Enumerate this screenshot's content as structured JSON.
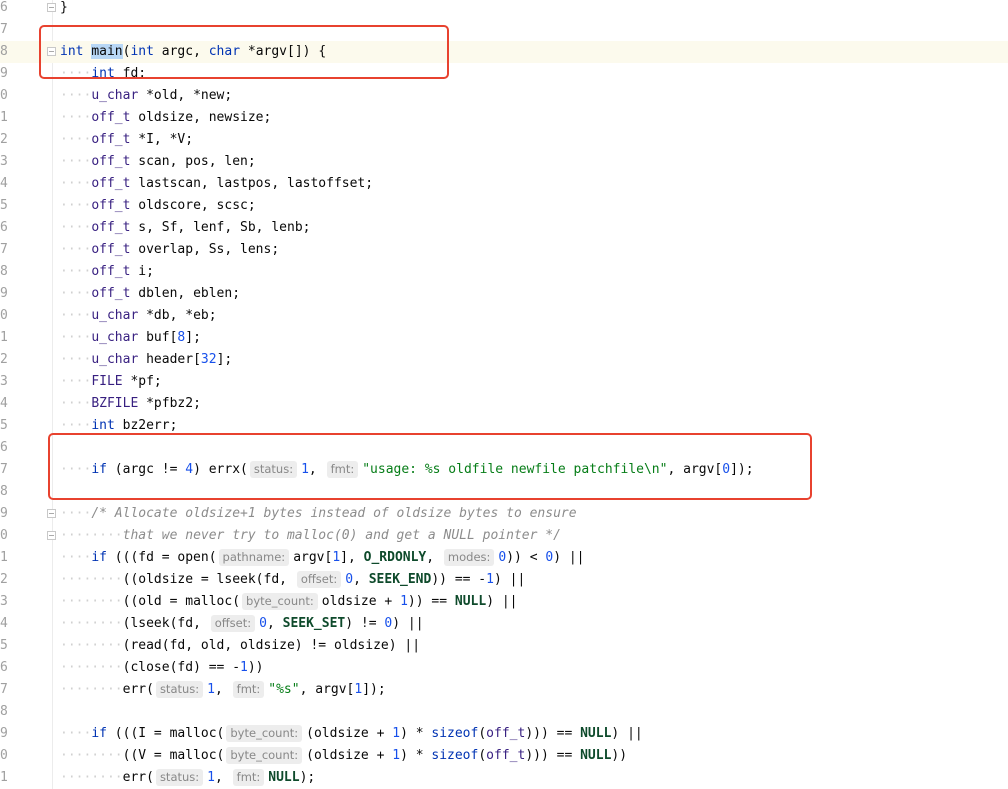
{
  "editor": {
    "current_line_index": 2,
    "accent_box_color": "#e8422f",
    "lines": [
      {
        "n": "6",
        "indent": 0,
        "fold": true,
        "tokens": [
          [
            "p",
            "}"
          ]
        ]
      },
      {
        "n": "7",
        "indent": 0,
        "tokens": []
      },
      {
        "n": "8",
        "indent": 0,
        "fold": true,
        "tokens": [
          [
            "kw",
            "int"
          ],
          [
            "p",
            " "
          ],
          [
            "sel",
            "main"
          ],
          [
            "p",
            "("
          ],
          [
            "kw",
            "int"
          ],
          [
            "p",
            " argc, "
          ],
          [
            "kw",
            "char"
          ],
          [
            "p",
            " *argv[]) {"
          ]
        ]
      },
      {
        "n": "9",
        "indent": 4,
        "tokens": [
          [
            "kw",
            "int"
          ],
          [
            "p",
            " fd;"
          ]
        ]
      },
      {
        "n": "0",
        "indent": 4,
        "tokens": [
          [
            "type",
            "u_char"
          ],
          [
            "p",
            " *old, *new;"
          ]
        ]
      },
      {
        "n": "1",
        "indent": 4,
        "tokens": [
          [
            "type",
            "off_t"
          ],
          [
            "p",
            " oldsize, newsize;"
          ]
        ]
      },
      {
        "n": "2",
        "indent": 4,
        "tokens": [
          [
            "type",
            "off_t"
          ],
          [
            "p",
            " *I, *V;"
          ]
        ]
      },
      {
        "n": "3",
        "indent": 4,
        "tokens": [
          [
            "type",
            "off_t"
          ],
          [
            "p",
            " scan, pos, len;"
          ]
        ]
      },
      {
        "n": "4",
        "indent": 4,
        "tokens": [
          [
            "type",
            "off_t"
          ],
          [
            "p",
            " lastscan, lastpos, lastoffset;"
          ]
        ]
      },
      {
        "n": "5",
        "indent": 4,
        "tokens": [
          [
            "type",
            "off_t"
          ],
          [
            "p",
            " oldscore, scsc;"
          ]
        ]
      },
      {
        "n": "6",
        "indent": 4,
        "tokens": [
          [
            "type",
            "off_t"
          ],
          [
            "p",
            " s, Sf, lenf, Sb, lenb;"
          ]
        ]
      },
      {
        "n": "7",
        "indent": 4,
        "tokens": [
          [
            "type",
            "off_t"
          ],
          [
            "p",
            " overlap, Ss, lens;"
          ]
        ]
      },
      {
        "n": "8",
        "indent": 4,
        "tokens": [
          [
            "type",
            "off_t"
          ],
          [
            "p",
            " i;"
          ]
        ]
      },
      {
        "n": "9",
        "indent": 4,
        "tokens": [
          [
            "type",
            "off_t"
          ],
          [
            "p",
            " dblen, eblen;"
          ]
        ]
      },
      {
        "n": "0",
        "indent": 4,
        "tokens": [
          [
            "type",
            "u_char"
          ],
          [
            "p",
            " *db, *eb;"
          ]
        ]
      },
      {
        "n": "1",
        "indent": 4,
        "tokens": [
          [
            "type",
            "u_char"
          ],
          [
            "p",
            " buf["
          ],
          [
            "num",
            "8"
          ],
          [
            "p",
            "];"
          ]
        ]
      },
      {
        "n": "2",
        "indent": 4,
        "tokens": [
          [
            "type",
            "u_char"
          ],
          [
            "p",
            " header["
          ],
          [
            "num",
            "32"
          ],
          [
            "p",
            "];"
          ]
        ]
      },
      {
        "n": "3",
        "indent": 4,
        "tokens": [
          [
            "type",
            "FILE"
          ],
          [
            "p",
            " *pf;"
          ]
        ]
      },
      {
        "n": "4",
        "indent": 4,
        "tokens": [
          [
            "type",
            "BZFILE"
          ],
          [
            "p",
            " *pfbz2;"
          ]
        ]
      },
      {
        "n": "5",
        "indent": 4,
        "tokens": [
          [
            "kw",
            "int"
          ],
          [
            "p",
            " bz2err;"
          ]
        ]
      },
      {
        "n": "6",
        "indent": 0,
        "tokens": []
      },
      {
        "n": "7",
        "indent": 4,
        "tokens": [
          [
            "kw",
            "if"
          ],
          [
            "p",
            " (argc != "
          ],
          [
            "num",
            "4"
          ],
          [
            "p",
            ") errx("
          ],
          [
            "hint",
            "status:"
          ],
          [
            "num",
            "1"
          ],
          [
            "p",
            ", "
          ],
          [
            "hint",
            "fmt:"
          ],
          [
            "str",
            "\"usage: %s oldfile newfile patchfile\\n\""
          ],
          [
            "p",
            ", argv["
          ],
          [
            "num",
            "0"
          ],
          [
            "p",
            "]);"
          ]
        ]
      },
      {
        "n": "8",
        "indent": 0,
        "tokens": []
      },
      {
        "n": "9",
        "indent": 4,
        "fold": true,
        "tokens": [
          [
            "cm",
            "/* Allocate oldsize+1 bytes instead of oldsize bytes to ensure"
          ]
        ]
      },
      {
        "n": "0",
        "indent": 8,
        "fold": true,
        "tokens": [
          [
            "cm",
            "that we never try to malloc(0) and get a NULL pointer */"
          ]
        ]
      },
      {
        "n": "1",
        "indent": 4,
        "tokens": [
          [
            "kw",
            "if"
          ],
          [
            "p",
            " (((fd = open("
          ],
          [
            "hint",
            "pathname:"
          ],
          [
            "p",
            "argv["
          ],
          [
            "num",
            "1"
          ],
          [
            "p",
            "], "
          ],
          [
            "const",
            "O_RDONLY"
          ],
          [
            "p",
            ", "
          ],
          [
            "hint",
            "modes:"
          ],
          [
            "num",
            "0"
          ],
          [
            "p",
            ")) < "
          ],
          [
            "num",
            "0"
          ],
          [
            "p",
            ") ||"
          ]
        ]
      },
      {
        "n": "2",
        "indent": 8,
        "tokens": [
          [
            "p",
            "((oldsize = lseek(fd, "
          ],
          [
            "hint",
            "offset:"
          ],
          [
            "num",
            "0"
          ],
          [
            "p",
            ", "
          ],
          [
            "const",
            "SEEK_END"
          ],
          [
            "p",
            ")) == -"
          ],
          [
            "num",
            "1"
          ],
          [
            "p",
            ") ||"
          ]
        ]
      },
      {
        "n": "3",
        "indent": 8,
        "tokens": [
          [
            "p",
            "((old = malloc("
          ],
          [
            "hint",
            "byte_count:"
          ],
          [
            "p",
            "oldsize + "
          ],
          [
            "num",
            "1"
          ],
          [
            "p",
            ")) == "
          ],
          [
            "const",
            "NULL"
          ],
          [
            "p",
            ") ||"
          ]
        ]
      },
      {
        "n": "4",
        "indent": 8,
        "tokens": [
          [
            "p",
            "(lseek(fd, "
          ],
          [
            "hint",
            "offset:"
          ],
          [
            "num",
            "0"
          ],
          [
            "p",
            ", "
          ],
          [
            "const",
            "SEEK_SET"
          ],
          [
            "p",
            ") != "
          ],
          [
            "num",
            "0"
          ],
          [
            "p",
            ") ||"
          ]
        ]
      },
      {
        "n": "5",
        "indent": 8,
        "tokens": [
          [
            "p",
            "(read(fd, old, oldsize) != oldsize) ||"
          ]
        ]
      },
      {
        "n": "6",
        "indent": 8,
        "tokens": [
          [
            "p",
            "(close(fd) == -"
          ],
          [
            "num",
            "1"
          ],
          [
            "p",
            "))"
          ]
        ]
      },
      {
        "n": "7",
        "indent": 8,
        "tokens": [
          [
            "p",
            "err("
          ],
          [
            "hint",
            "status:"
          ],
          [
            "num",
            "1"
          ],
          [
            "p",
            ", "
          ],
          [
            "hint",
            "fmt:"
          ],
          [
            "str",
            "\"%s\""
          ],
          [
            "p",
            ", argv["
          ],
          [
            "num",
            "1"
          ],
          [
            "p",
            "]);"
          ]
        ]
      },
      {
        "n": "8",
        "indent": 0,
        "tokens": []
      },
      {
        "n": "9",
        "indent": 4,
        "tokens": [
          [
            "kw",
            "if"
          ],
          [
            "p",
            " (((I = malloc("
          ],
          [
            "hint",
            "byte_count:"
          ],
          [
            "p",
            "(oldsize + "
          ],
          [
            "num",
            "1"
          ],
          [
            "p",
            ") * "
          ],
          [
            "kw",
            "sizeof"
          ],
          [
            "p",
            "("
          ],
          [
            "type",
            "off_t"
          ],
          [
            "p",
            "))) == "
          ],
          [
            "const",
            "NULL"
          ],
          [
            "p",
            ") ||"
          ]
        ]
      },
      {
        "n": "0",
        "indent": 8,
        "tokens": [
          [
            "p",
            "((V = malloc("
          ],
          [
            "hint",
            "byte_count:"
          ],
          [
            "p",
            "(oldsize + "
          ],
          [
            "num",
            "1"
          ],
          [
            "p",
            ") * "
          ],
          [
            "kw",
            "sizeof"
          ],
          [
            "p",
            "("
          ],
          [
            "type",
            "off_t"
          ],
          [
            "p",
            "))) == "
          ],
          [
            "const",
            "NULL"
          ],
          [
            "p",
            "))"
          ]
        ]
      },
      {
        "n": "1",
        "indent": 8,
        "tokens": [
          [
            "p",
            "err("
          ],
          [
            "hint",
            "status:"
          ],
          [
            "num",
            "1"
          ],
          [
            "p",
            ", "
          ],
          [
            "hint",
            "fmt:"
          ],
          [
            "const",
            "NULL"
          ],
          [
            "p",
            ");"
          ]
        ]
      }
    ]
  }
}
